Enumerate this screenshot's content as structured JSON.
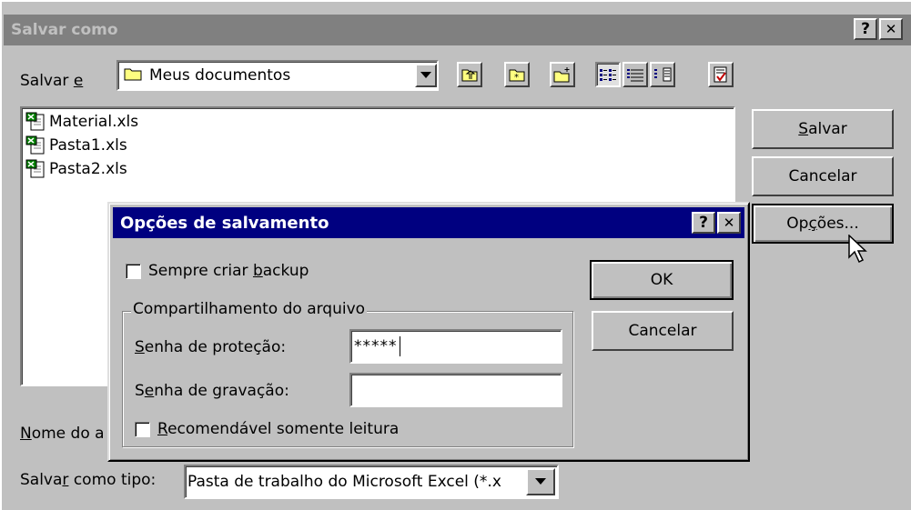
{
  "save_dialog": {
    "title": "Salvar como",
    "help_button": "?",
    "close_button": "✕",
    "save_in_label_prefix": "Salvar ",
    "save_in_label_hot": "e",
    "save_in_value": "Meus documentos",
    "files": [
      {
        "name": "Material.xls",
        "icon": "excel-file-icon"
      },
      {
        "name": "Pasta1.xls",
        "icon": "excel-file-icon"
      },
      {
        "name": "Pasta2.xls",
        "icon": "excel-file-icon"
      }
    ],
    "filename_label_hot": "N",
    "filename_label_rest": "ome do a",
    "filetype_label_prefix": "Salva",
    "filetype_label_hot": "r",
    "filetype_label_rest": " como tipo:",
    "filetype_value": "Pasta de trabalho do Microsoft Excel (*.x",
    "buttons": {
      "save_hot": "S",
      "save_rest": "alvar",
      "cancel": "Cancelar",
      "options_prefix": "Op",
      "options_hot": "ç",
      "options_rest": "ões..."
    },
    "toolbar_icons": [
      "up-one-level-icon",
      "favorites-icon",
      "new-folder-icon",
      "list-view-icon",
      "details-view-icon",
      "properties-view-icon",
      "commands-icon"
    ]
  },
  "options_dialog": {
    "title": "Opções de salvamento",
    "help_button": "?",
    "close_button": "✕",
    "backup_label_prefix": "Sempre criar ",
    "backup_label_hot": "b",
    "backup_label_rest": "ackup",
    "backup_checked": false,
    "group_label": "Compartilhamento do arquivo",
    "protect_label_hot": "S",
    "protect_label_rest": "enha de proteção:",
    "protect_value": "*****",
    "write_label_prefix": "S",
    "write_label_hot": "e",
    "write_label_rest": "nha de gravação:",
    "write_value": "",
    "readonly_label_hot": "R",
    "readonly_label_rest": "ecomendável somente leitura",
    "readonly_checked": false,
    "ok_button": "OK",
    "cancel_button": "Cancelar"
  }
}
